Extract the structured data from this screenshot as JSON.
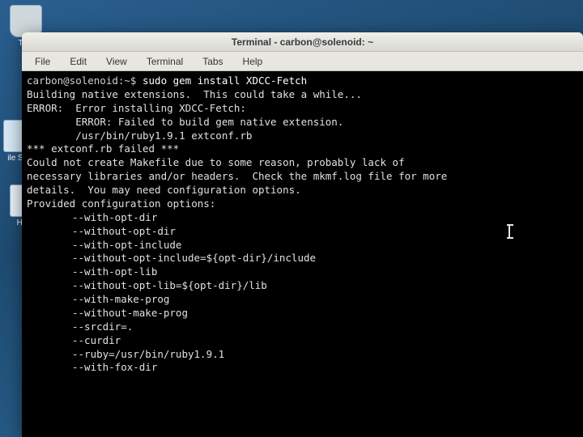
{
  "desktop": {
    "trash_label": "Tr…",
    "files_label": "ile S…",
    "home_label": "Ho…"
  },
  "window": {
    "title": "Terminal - carbon@solenoid: ~"
  },
  "menu": {
    "file": "File",
    "edit": "Edit",
    "view": "View",
    "terminal": "Terminal",
    "tabs": "Tabs",
    "help": "Help"
  },
  "terminal": {
    "prompt": "carbon@solenoid:~$ ",
    "command": "sudo gem install XDCC-Fetch",
    "lines": {
      "l1": "Building native extensions.  This could take a while...",
      "l2": "ERROR:  Error installing XDCC-Fetch:",
      "l3": "        ERROR: Failed to build gem native extension.",
      "l4": "",
      "l5": "        /usr/bin/ruby1.9.1 extconf.rb",
      "l6": "*** extconf.rb failed ***",
      "l7": "Could not create Makefile due to some reason, probably lack of",
      "l8": "necessary libraries and/or headers.  Check the mkmf.log file for more",
      "l9": "details.  You may need configuration options.",
      "l10": "",
      "l11": "Provided configuration options:"
    },
    "options": [
      "--with-opt-dir",
      "--without-opt-dir",
      "--with-opt-include",
      "--without-opt-include=${opt-dir}/include",
      "--with-opt-lib",
      "--without-opt-lib=${opt-dir}/lib",
      "--with-make-prog",
      "--without-make-prog",
      "--srcdir=.",
      "--curdir",
      "--ruby=/usr/bin/ruby1.9.1",
      "--with-fox-dir"
    ]
  }
}
